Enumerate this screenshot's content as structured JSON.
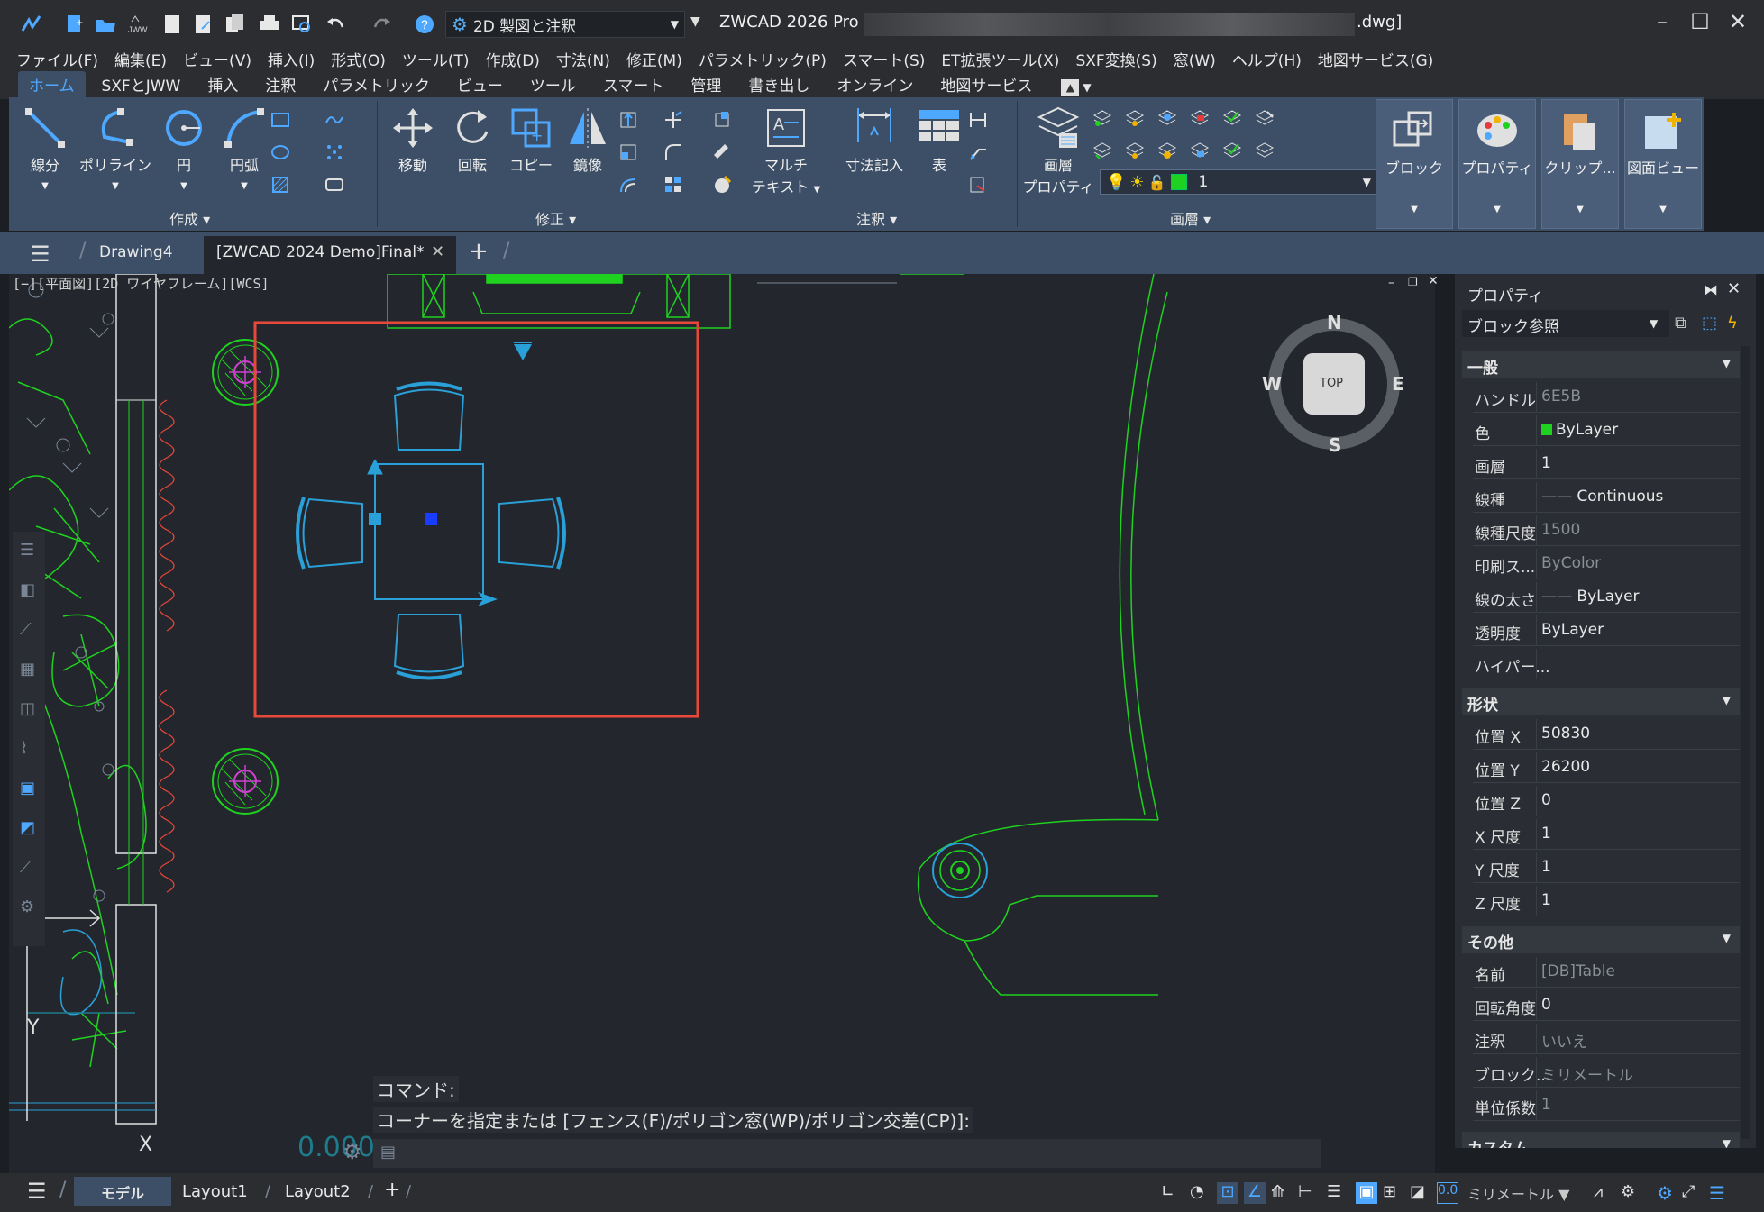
{
  "titlebar": {
    "workspace": "2D 製図と注釈",
    "app_title": "ZWCAD 2026 Pro - [",
    "file_ext": ".dwg]"
  },
  "menu": [
    "ファイル(F)",
    "編集(E)",
    "ビュー(V)",
    "挿入(I)",
    "形式(O)",
    "ツール(T)",
    "作成(D)",
    "寸法(N)",
    "修正(M)",
    "パラメトリック(P)",
    "スマート(S)",
    "ET拡張ツール(X)",
    "SXF変換(S)",
    "窓(W)",
    "ヘルプ(H)",
    "地図サービス(G)"
  ],
  "ribbon_tabs": [
    "ホーム",
    "SXFとJWW",
    "挿入",
    "注釈",
    "パラメトリック",
    "ビュー",
    "ツール",
    "スマート",
    "管理",
    "書き出し",
    "オンライン",
    "地図サービス"
  ],
  "ribbon": {
    "draw": {
      "line": "線分",
      "polyline": "ポリライン",
      "circle": "円",
      "arc": "円弧",
      "panel": "作成"
    },
    "modify": {
      "move": "移動",
      "rotate": "回転",
      "copy": "コピー",
      "mirror": "鏡像",
      "panel": "修正"
    },
    "annotation": {
      "mtext_1": "マルチ",
      "mtext_2": "テキスト",
      "dimension": "寸法記入",
      "table": "表",
      "panel": "注釈"
    },
    "layers": {
      "props_1": "画層",
      "props_2": "プロパティ",
      "current_layer": "1",
      "panel": "画層"
    },
    "block": "ブロック",
    "properties": "プロパティ",
    "clipboard": "クリップ...",
    "sheetview": "図面ビュー"
  },
  "doc_tabs": {
    "tab1": "Drawing4",
    "tab2": "[ZWCAD 2024 Demo]Final*"
  },
  "viewport_label": "[−][平面図][2D ワイヤフレーム][WCS]",
  "viewcube": {
    "n": "N",
    "s": "S",
    "e": "E",
    "w": "W",
    "top": "TOP"
  },
  "ucs": {
    "x": "X",
    "y": "Y"
  },
  "command": {
    "label": "コマンド:",
    "prompt": "コーナーを指定または [フェンス(F)/ポリゴン窓(WP)/ポリゴン交差(CP)]:"
  },
  "coord_readout": "0.000",
  "properties_panel": {
    "title": "プロパティ",
    "selection": "ブロック参照",
    "general_title": "一般",
    "general": [
      {
        "k": "ハンドル",
        "v": "6E5B",
        "dim": true
      },
      {
        "k": "色",
        "v": "ByLayer",
        "dim": false
      },
      {
        "k": "画層",
        "v": "1",
        "dim": false
      },
      {
        "k": "線種",
        "v": "—— Continuous",
        "dim": false
      },
      {
        "k": "線種尺度",
        "v": "1500",
        "dim": true
      },
      {
        "k": "印刷ス...",
        "v": "ByColor",
        "dim": true
      },
      {
        "k": "線の太さ",
        "v": "—— ByLayer",
        "dim": false
      },
      {
        "k": "透明度",
        "v": "ByLayer",
        "dim": false
      },
      {
        "k": "ハイパー...",
        "v": "",
        "dim": false
      }
    ],
    "geometry_title": "形状",
    "geometry": [
      {
        "k": "位置 X",
        "v": "50830"
      },
      {
        "k": "位置 Y",
        "v": "26200"
      },
      {
        "k": "位置 Z",
        "v": "0"
      },
      {
        "k": "X 尺度",
        "v": "1"
      },
      {
        "k": "Y 尺度",
        "v": "1"
      },
      {
        "k": "Z 尺度",
        "v": "1"
      }
    ],
    "misc_title": "その他",
    "misc": [
      {
        "k": "名前",
        "v": "[DB]Table",
        "dim": true
      },
      {
        "k": "回転角度",
        "v": "0",
        "dim": false
      },
      {
        "k": "注釈",
        "v": "いいえ",
        "dim": true
      },
      {
        "k": "ブロック...",
        "v": "ミリメートル",
        "dim": true
      },
      {
        "k": "単位係数",
        "v": "1",
        "dim": true
      }
    ],
    "custom_title": "カスタム"
  },
  "status": {
    "model": "モデル",
    "layout1": "Layout1",
    "layout2": "Layout2",
    "units": "ミリメートル"
  },
  "colors": {
    "accent": "#4fa8ff",
    "ribbon": "#3d4f66",
    "canvas": "#23272d",
    "selection": "#e8483a",
    "block": "#2aa0d8",
    "green": "#1fd21f"
  }
}
